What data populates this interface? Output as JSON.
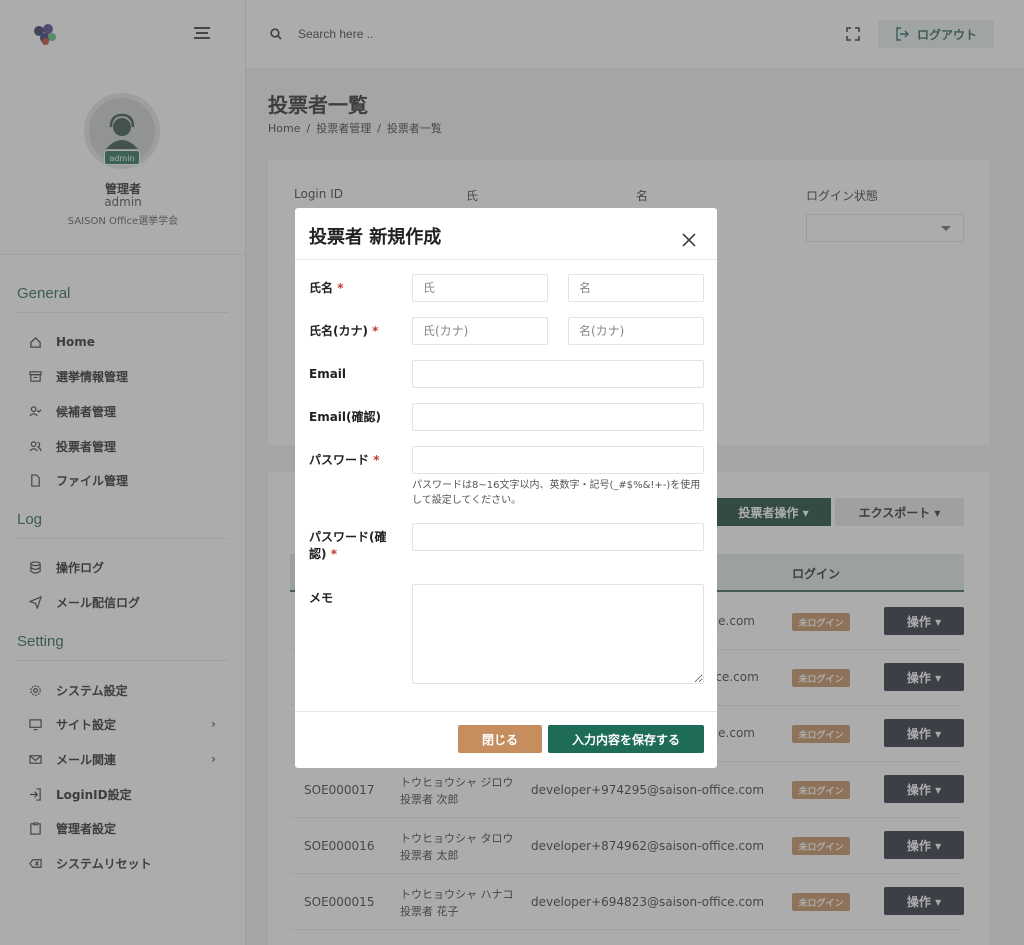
{
  "user": {
    "role": "管理者",
    "id": "admin",
    "org": "SAISON Office選挙学会",
    "avatar_badge": "admin"
  },
  "sidebar": {
    "sections": [
      {
        "title": "General",
        "items": [
          {
            "label": "Home",
            "icon": "home-icon"
          },
          {
            "label": "選挙情報管理",
            "icon": "archive-icon"
          },
          {
            "label": "候補者管理",
            "icon": "user-check-icon"
          },
          {
            "label": "投票者管理",
            "icon": "users-icon"
          },
          {
            "label": "ファイル管理",
            "icon": "file-icon"
          }
        ]
      },
      {
        "title": "Log",
        "items": [
          {
            "label": "操作ログ",
            "icon": "database-icon"
          },
          {
            "label": "メール配信ログ",
            "icon": "send-icon"
          }
        ]
      },
      {
        "title": "Setting",
        "items": [
          {
            "label": "システム設定",
            "icon": "gear-icon"
          },
          {
            "label": "サイト設定",
            "icon": "monitor-icon"
          },
          {
            "label": "メール関連",
            "icon": "mail-icon"
          },
          {
            "label": "LoginID設定",
            "icon": "login-icon"
          },
          {
            "label": "管理者設定",
            "icon": "clipboard-icon"
          },
          {
            "label": "システムリセット",
            "icon": "backspace-icon"
          }
        ]
      }
    ]
  },
  "topbar": {
    "search_placeholder": "Search here ..",
    "logout_label": "ログアウト"
  },
  "page": {
    "title": "投票者一覧",
    "breadcrumb": [
      "Home",
      "/",
      "投票者管理",
      "/",
      "投票者一覧"
    ]
  },
  "filters": {
    "login_id": "Login ID",
    "last_name": "氏",
    "first_name": "名",
    "login_status": "ログイン状態"
  },
  "table": {
    "voter_op_label": "投票者操作 ▾",
    "export_label": "エクスポート ▾",
    "login_header": "ログイン",
    "op_label": "操作 ▾",
    "rows": [
      {
        "email_partial": "fice.com",
        "badge": "未ログイン"
      },
      {
        "email_partial": "ice.com",
        "badge": "未ログイン"
      },
      {
        "email_partial": "fice.com",
        "badge": "未ログイン"
      },
      {
        "id": "SOE000017",
        "kana": "トウヒョウシャ ジロウ",
        "name": "投票者 次郎",
        "email": "developer+974295@saison-office.com",
        "badge": "未ログイン"
      },
      {
        "id": "SOE000016",
        "kana": "トウヒョウシャ タロウ",
        "name": "投票者 太郎",
        "email": "developer+874962@saison-office.com",
        "badge": "未ログイン"
      },
      {
        "id": "SOE000015",
        "kana": "トウヒョウシャ ハナコ",
        "name": "投票者 花子",
        "email": "developer+694823@saison-office.com",
        "badge": "未ログイン"
      }
    ]
  },
  "modal": {
    "title": "投票者 新規作成",
    "required_mark": "*",
    "name_label": "氏名",
    "kana_label": "氏名(カナ)",
    "email_label": "Email",
    "email_confirm_label": "Email(確認)",
    "password_label": "パスワード",
    "password_confirm_label_1": "パスワード(確",
    "password_confirm_label_2": "認)",
    "memo_label": "メモ",
    "last_name_placeholder": "氏",
    "first_name_placeholder": "名",
    "last_kana_placeholder": "氏(カナ)",
    "first_kana_placeholder": "名(カナ)",
    "password_help": "パスワードは8~16文字以内、英数字・記号(_#$%&!+-)を使用して設定してください。",
    "close_label": "閉じる",
    "save_label": "入力内容を保存する"
  },
  "colors": {
    "brand": "#1e6b58",
    "dark_green": "#0d3b30",
    "badge": "#c48a5a",
    "close_button": "#c68e5e"
  }
}
